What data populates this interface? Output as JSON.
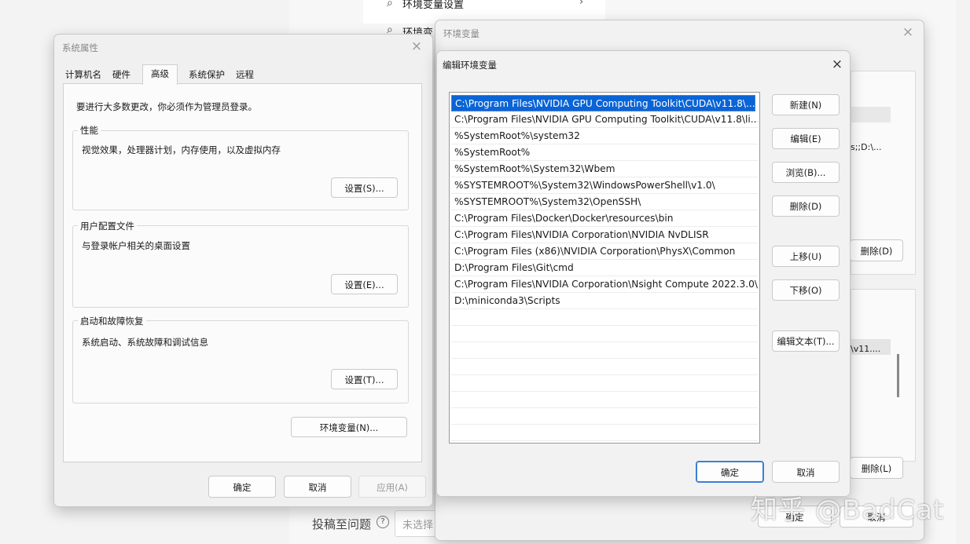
{
  "background": {
    "settings_search_item": "环境变量设置",
    "settings_search_item2": "环境变",
    "env_fragment_1": "s;;D:\\...",
    "env_fragment_2": "\\v11....",
    "env_delete_top": "删除(D)",
    "env_delete_bottom": "删除(L)",
    "env_ok": "确定",
    "env_cancel": "取消",
    "footer_label": "投稿至问题",
    "footer_unselected": "未选择"
  },
  "system_properties": {
    "title": "系统属性",
    "tabs": [
      "计算机名",
      "硬件",
      "高级",
      "系统保护",
      "远程"
    ],
    "active_tab": "高级",
    "admin_note": "要进行大多数更改，你必须作为管理员登录。",
    "groups": [
      {
        "label": "性能",
        "desc": "视觉效果，处理器计划，内存使用，以及虚拟内存",
        "button": "设置(S)..."
      },
      {
        "label": "用户配置文件",
        "desc": "与登录帐户相关的桌面设置",
        "button": "设置(E)..."
      },
      {
        "label": "启动和故障恢复",
        "desc": "系统启动、系统故障和调试信息",
        "button": "设置(T)..."
      }
    ],
    "env_button": "环境变量(N)...",
    "ok": "确定",
    "cancel": "取消",
    "apply": "应用(A)"
  },
  "env_vars_window": {
    "title": "环境变量"
  },
  "edit_env": {
    "title": "编辑环境变量",
    "entries": [
      "C:\\Program Files\\NVIDIA GPU Computing Toolkit\\CUDA\\v11.8\\...",
      "C:\\Program Files\\NVIDIA GPU Computing Toolkit\\CUDA\\v11.8\\li...",
      "%SystemRoot%\\system32",
      "%SystemRoot%",
      "%SystemRoot%\\System32\\Wbem",
      "%SYSTEMROOT%\\System32\\WindowsPowerShell\\v1.0\\",
      "%SYSTEMROOT%\\System32\\OpenSSH\\",
      "C:\\Program Files\\Docker\\Docker\\resources\\bin",
      "C:\\Program Files\\NVIDIA Corporation\\NVIDIA NvDLISR",
      "C:\\Program Files (x86)\\NVIDIA Corporation\\PhysX\\Common",
      "D:\\Program Files\\Git\\cmd",
      "C:\\Program Files\\NVIDIA Corporation\\Nsight Compute 2022.3.0\\",
      "D:\\miniconda3\\Scripts"
    ],
    "selected_index": 0,
    "buttons": {
      "new": "新建(N)",
      "edit": "编辑(E)",
      "browse": "浏览(B)...",
      "delete": "删除(D)",
      "move_up": "上移(U)",
      "move_down": "下移(O)",
      "edit_text": "编辑文本(T)..."
    },
    "ok": "确定",
    "cancel": "取消"
  },
  "watermark": "知乎 @BadCat",
  "colors": {
    "selection": "#0a64d6",
    "primary_border": "#3a7fd5"
  }
}
